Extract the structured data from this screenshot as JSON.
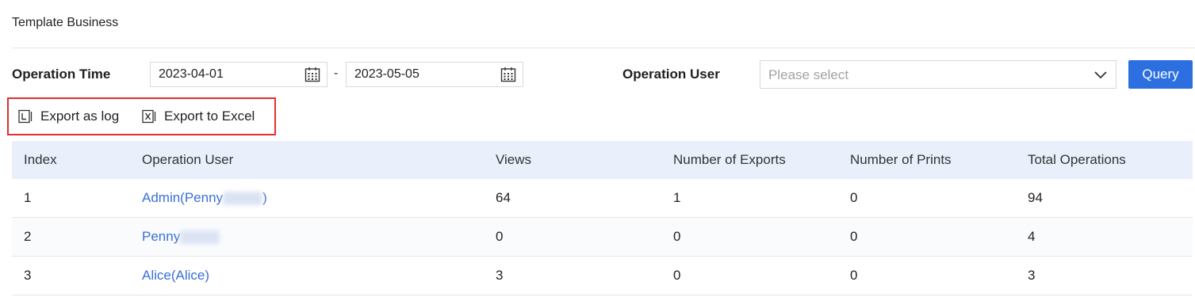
{
  "page": {
    "title": "Template Business"
  },
  "filters": {
    "time_label": "Operation Time",
    "date_from": "2023-04-01",
    "date_separator": "-",
    "date_to": "2023-05-05",
    "user_label": "Operation User",
    "user_placeholder": "Please select",
    "query_label": "Query"
  },
  "exports": {
    "log_label": "Export as log",
    "excel_label": "Export to Excel",
    "highlight_color": "#e03030"
  },
  "table": {
    "columns": [
      "Index",
      "Operation User",
      "Views",
      "Number of Exports",
      "Number of Prints",
      "Total Operations"
    ],
    "rows": [
      {
        "index": "1",
        "user_prefix": "Admin(Penny",
        "user_suffix": ")",
        "views": "64",
        "exports": "1",
        "prints": "0",
        "total": "94"
      },
      {
        "index": "2",
        "user_prefix": "Penny",
        "user_suffix": "",
        "views": "0",
        "exports": "0",
        "prints": "0",
        "total": "4"
      },
      {
        "index": "3",
        "user_prefix": "Alice(Alice)",
        "user_suffix": "",
        "views": "3",
        "exports": "0",
        "prints": "0",
        "total": "3"
      }
    ]
  },
  "colors": {
    "accent": "#2c6fe0",
    "link": "#3a6fd8",
    "table_header_bg": "#e9f0fb"
  },
  "icons": [
    "calendar-icon",
    "chevron-down-icon",
    "export-log-icon",
    "export-excel-icon"
  ]
}
